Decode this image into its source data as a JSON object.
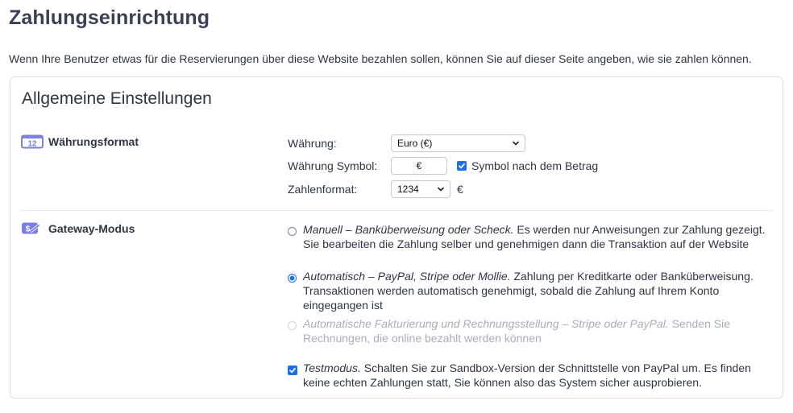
{
  "page": {
    "title": "Zahlungseinrichtung",
    "intro": "Wenn Ihre Benutzer etwas für die Reservierungen über diese Website bezahlen sollen, können Sie auf dieser Seite angeben, wie sie zahlen können."
  },
  "general": {
    "title": "Allgemeine Einstellungen",
    "currency_section": {
      "icon": "calendar-12-icon",
      "title": "Währungsformat",
      "currency_label": "Währung:",
      "currency_value": "Euro (€)",
      "symbol_label": "Währung Symbol:",
      "symbol_value": "€",
      "symbol_after_label": "Symbol nach dem Betrag",
      "symbol_after_checked": true,
      "number_format_label": "Zahlenformat:",
      "number_format_value": "1234",
      "number_format_symbol": "€"
    },
    "gateway_section": {
      "icon": "payment-card-icon",
      "title": "Gateway-Modus",
      "options": [
        {
          "title": "Manuell – Banküberweisung oder Scheck.",
          "description": "Es werden nur Anweisungen zur Zahlung gezeigt. Sie bearbeiten die Zahlung selber und genehmigen dann die Transaktion auf der Website",
          "selected": false,
          "disabled": false
        },
        {
          "title": "Automatisch – PayPal, Stripe oder Mollie.",
          "description": "Zahlung per Kreditkarte oder Banküberweisung. Transaktionen werden automatisch genehmigt, sobald die Zahlung auf Ihrem Konto eingegangen ist",
          "selected": true,
          "disabled": false
        },
        {
          "title": "Automatische Fakturierung und Rechnungsstellung – Stripe oder PayPal.",
          "description": "Senden Sie Rechnungen, die online bezahlt werden können",
          "selected": false,
          "disabled": true
        }
      ],
      "test_mode": {
        "title": "Testmodus.",
        "description": "Schalten Sie zur Sandbox-Version der Schnittstelle von PayPal um. Es finden keine echten Zahlungen statt, Sie können also das System sicher ausprobieren.",
        "checked": true
      }
    }
  },
  "colors": {
    "accent": "#1e6fe6",
    "icon": "#7b7fe0",
    "text": "#2f3542",
    "disabled_text": "#a9aeb6"
  }
}
